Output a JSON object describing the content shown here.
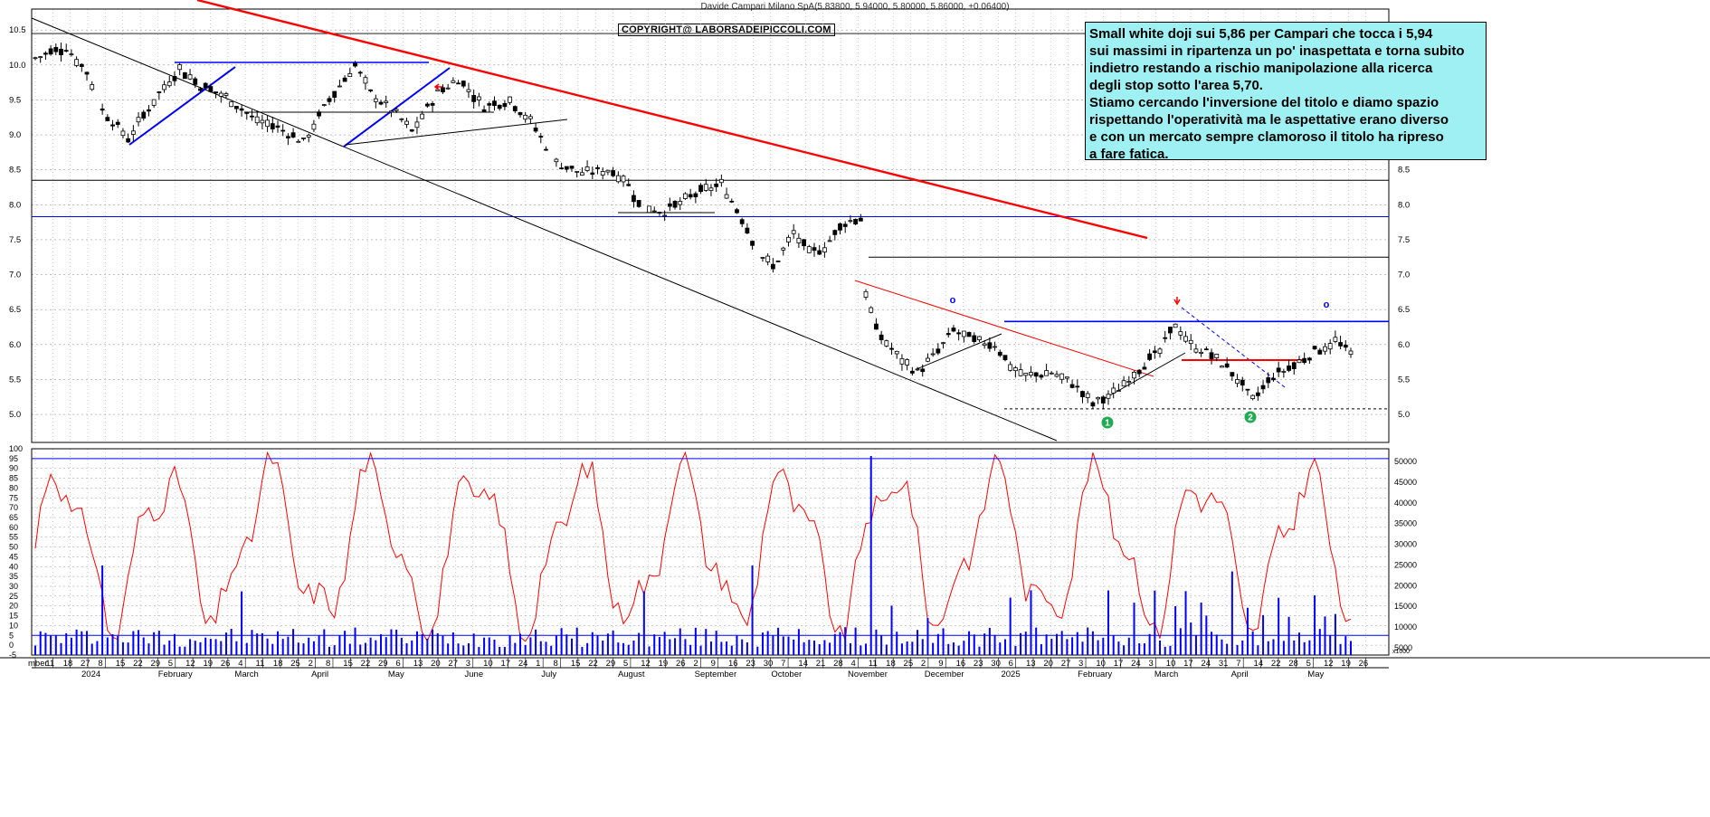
{
  "header": {
    "title": "Davide Campari Milano SpA(5.83800, 5.94000, 5.80000, 5.86000, +0.06400)",
    "copyright": "COPYRIGHT@ LABORSADEIPICCOLI.COM"
  },
  "annotation": {
    "lines": [
      "Small white doji sui 5,86 per Campari che tocca i 5,94",
      "sui massimi in ripartenza un po' inaspettata e torna subito",
      "indietro restando a rischio manipolazione alla ricerca",
      "degli stop sotto l'area 5,70.",
      "Stiamo cercando l'inversione del titolo e diamo spazio",
      "rispettando l'operatività ma le aspettative erano diverso",
      "e con un mercato sempre clamoroso il titolo ha ripreso",
      "a fare fatica."
    ]
  },
  "markers": {
    "one": "1",
    "two": "2",
    "o_symbol": "o"
  },
  "colors": {
    "price": "#000000",
    "trend_red": "#ff0000",
    "trend_blue": "#0000ff",
    "oscillator": "#ff0000",
    "volume": "#0000ff",
    "note_bg": "#9ff0f2",
    "marker_green": "#22aa55"
  },
  "chart_data": [
    {
      "type": "candlestick",
      "title": "Davide Campari Milano SpA(5.83800, 5.94000, 5.80000, 5.86000, +0.06400)",
      "ylim": [
        4.6,
        10.8
      ],
      "y_ticks": [
        "10.5",
        "10.0",
        "9.5",
        "9.0",
        "8.5",
        "8.0",
        "7.5",
        "7.0",
        "6.5",
        "6.0",
        "5.5",
        "5.0"
      ],
      "grid": true,
      "x_ticks": [
        {
          "label": "mber"
        },
        {
          "label": "11"
        },
        {
          "label": "18"
        },
        {
          "label": "27"
        },
        {
          "label": "8"
        },
        {
          "label": "15"
        },
        {
          "label": "22"
        },
        {
          "label": "29"
        },
        {
          "label": "5"
        },
        {
          "label": "12"
        },
        {
          "label": "19"
        },
        {
          "label": "26"
        },
        {
          "label": "4"
        },
        {
          "label": "11"
        },
        {
          "label": "18"
        },
        {
          "label": "25"
        },
        {
          "label": "2"
        },
        {
          "label": "8"
        },
        {
          "label": "15"
        },
        {
          "label": "22"
        },
        {
          "label": "29"
        },
        {
          "label": "6"
        },
        {
          "label": "13"
        },
        {
          "label": "20"
        },
        {
          "label": "27"
        },
        {
          "label": "3"
        },
        {
          "label": "10"
        },
        {
          "label": "17"
        },
        {
          "label": "24"
        },
        {
          "label": "1"
        },
        {
          "label": "8"
        },
        {
          "label": "15"
        },
        {
          "label": "22"
        },
        {
          "label": "29"
        },
        {
          "label": "5"
        },
        {
          "label": "12"
        },
        {
          "label": "19"
        },
        {
          "label": "26"
        },
        {
          "label": "2"
        },
        {
          "label": "9"
        },
        {
          "label": "16"
        },
        {
          "label": "23"
        },
        {
          "label": "30"
        },
        {
          "label": "7"
        },
        {
          "label": "14"
        },
        {
          "label": "21"
        },
        {
          "label": "28"
        },
        {
          "label": "4"
        },
        {
          "label": "11"
        },
        {
          "label": "18"
        },
        {
          "label": "25"
        },
        {
          "label": "2"
        },
        {
          "label": "9"
        },
        {
          "label": "16"
        },
        {
          "label": "23"
        },
        {
          "label": "30"
        },
        {
          "label": "6"
        },
        {
          "label": "13"
        },
        {
          "label": "20"
        },
        {
          "label": "27"
        },
        {
          "label": "3"
        },
        {
          "label": "10"
        },
        {
          "label": "17"
        },
        {
          "label": "24"
        },
        {
          "label": "3"
        },
        {
          "label": "10"
        },
        {
          "label": "17"
        },
        {
          "label": "24"
        },
        {
          "label": "31"
        },
        {
          "label": "7"
        },
        {
          "label": "14"
        },
        {
          "label": "22"
        },
        {
          "label": "28"
        },
        {
          "label": "5"
        },
        {
          "label": "12"
        },
        {
          "label": "19"
        },
        {
          "label": "26"
        }
      ],
      "month_labels": [
        "2024",
        "February",
        "March",
        "April",
        "May",
        "June",
        "July",
        "August",
        "September",
        "October",
        "November",
        "December",
        "2025",
        "February",
        "March",
        "April",
        "May"
      ],
      "price_path": [
        [
          0,
          10.1
        ],
        [
          6,
          10.25
        ],
        [
          10,
          9.9
        ],
        [
          13,
          9.35
        ],
        [
          18,
          8.95
        ],
        [
          24,
          9.6
        ],
        [
          28,
          9.95
        ],
        [
          32,
          9.7
        ],
        [
          37,
          9.55
        ],
        [
          42,
          9.25
        ],
        [
          47,
          9.1
        ],
        [
          52,
          8.9
        ],
        [
          57,
          9.5
        ],
        [
          62,
          10.0
        ],
        [
          65,
          9.6
        ],
        [
          70,
          9.3
        ],
        [
          73,
          9.05
        ],
        [
          78,
          9.6
        ],
        [
          82,
          9.8
        ],
        [
          87,
          9.4
        ],
        [
          92,
          9.5
        ],
        [
          96,
          9.2
        ],
        [
          101,
          8.6
        ],
        [
          106,
          8.45
        ],
        [
          111,
          8.5
        ],
        [
          114,
          8.4
        ],
        [
          117,
          8.0
        ],
        [
          122,
          7.9
        ],
        [
          128,
          8.15
        ],
        [
          133,
          8.3
        ],
        [
          137,
          7.8
        ],
        [
          140,
          7.35
        ],
        [
          143,
          7.1
        ],
        [
          147,
          7.6
        ],
        [
          150,
          7.3
        ],
        [
          153,
          7.4
        ],
        [
          157,
          7.75
        ],
        [
          160,
          7.8
        ],
        [
          161,
          6.75
        ],
        [
          163,
          6.2
        ],
        [
          167,
          5.85
        ],
        [
          171,
          5.6
        ],
        [
          175,
          5.9
        ],
        [
          178,
          6.2
        ],
        [
          182,
          6.05
        ],
        [
          186,
          6.0
        ],
        [
          189,
          5.7
        ],
        [
          192,
          5.55
        ],
        [
          197,
          5.6
        ],
        [
          201,
          5.45
        ],
        [
          205,
          5.15
        ],
        [
          209,
          5.3
        ],
        [
          213,
          5.6
        ],
        [
          218,
          5.9
        ],
        [
          221,
          6.3
        ],
        [
          224,
          6.0
        ],
        [
          228,
          5.85
        ],
        [
          232,
          5.6
        ],
        [
          236,
          5.2
        ],
        [
          240,
          5.55
        ],
        [
          244,
          5.7
        ],
        [
          248,
          5.9
        ],
        [
          252,
          6.05
        ],
        [
          255,
          5.86
        ]
      ],
      "support_resistance": [
        8.35,
        7.83,
        7.25,
        6.33,
        5.08
      ]
    },
    {
      "type": "line",
      "title": "",
      "ylim": [
        -5,
        100
      ],
      "y_ticks": [
        "100",
        "95",
        "90",
        "85",
        "80",
        "75",
        "70",
        "65",
        "60",
        "55",
        "50",
        "45",
        "40",
        "35",
        "30",
        "25",
        "20",
        "15",
        "10",
        "5",
        "0",
        "-5"
      ],
      "volume_ticks": [
        "50000",
        "45000",
        "40000",
        "35000",
        "30000",
        "25000",
        "20000",
        "15000",
        "10000",
        "5000"
      ],
      "volume_unit": "x1000",
      "grid": true
    }
  ]
}
